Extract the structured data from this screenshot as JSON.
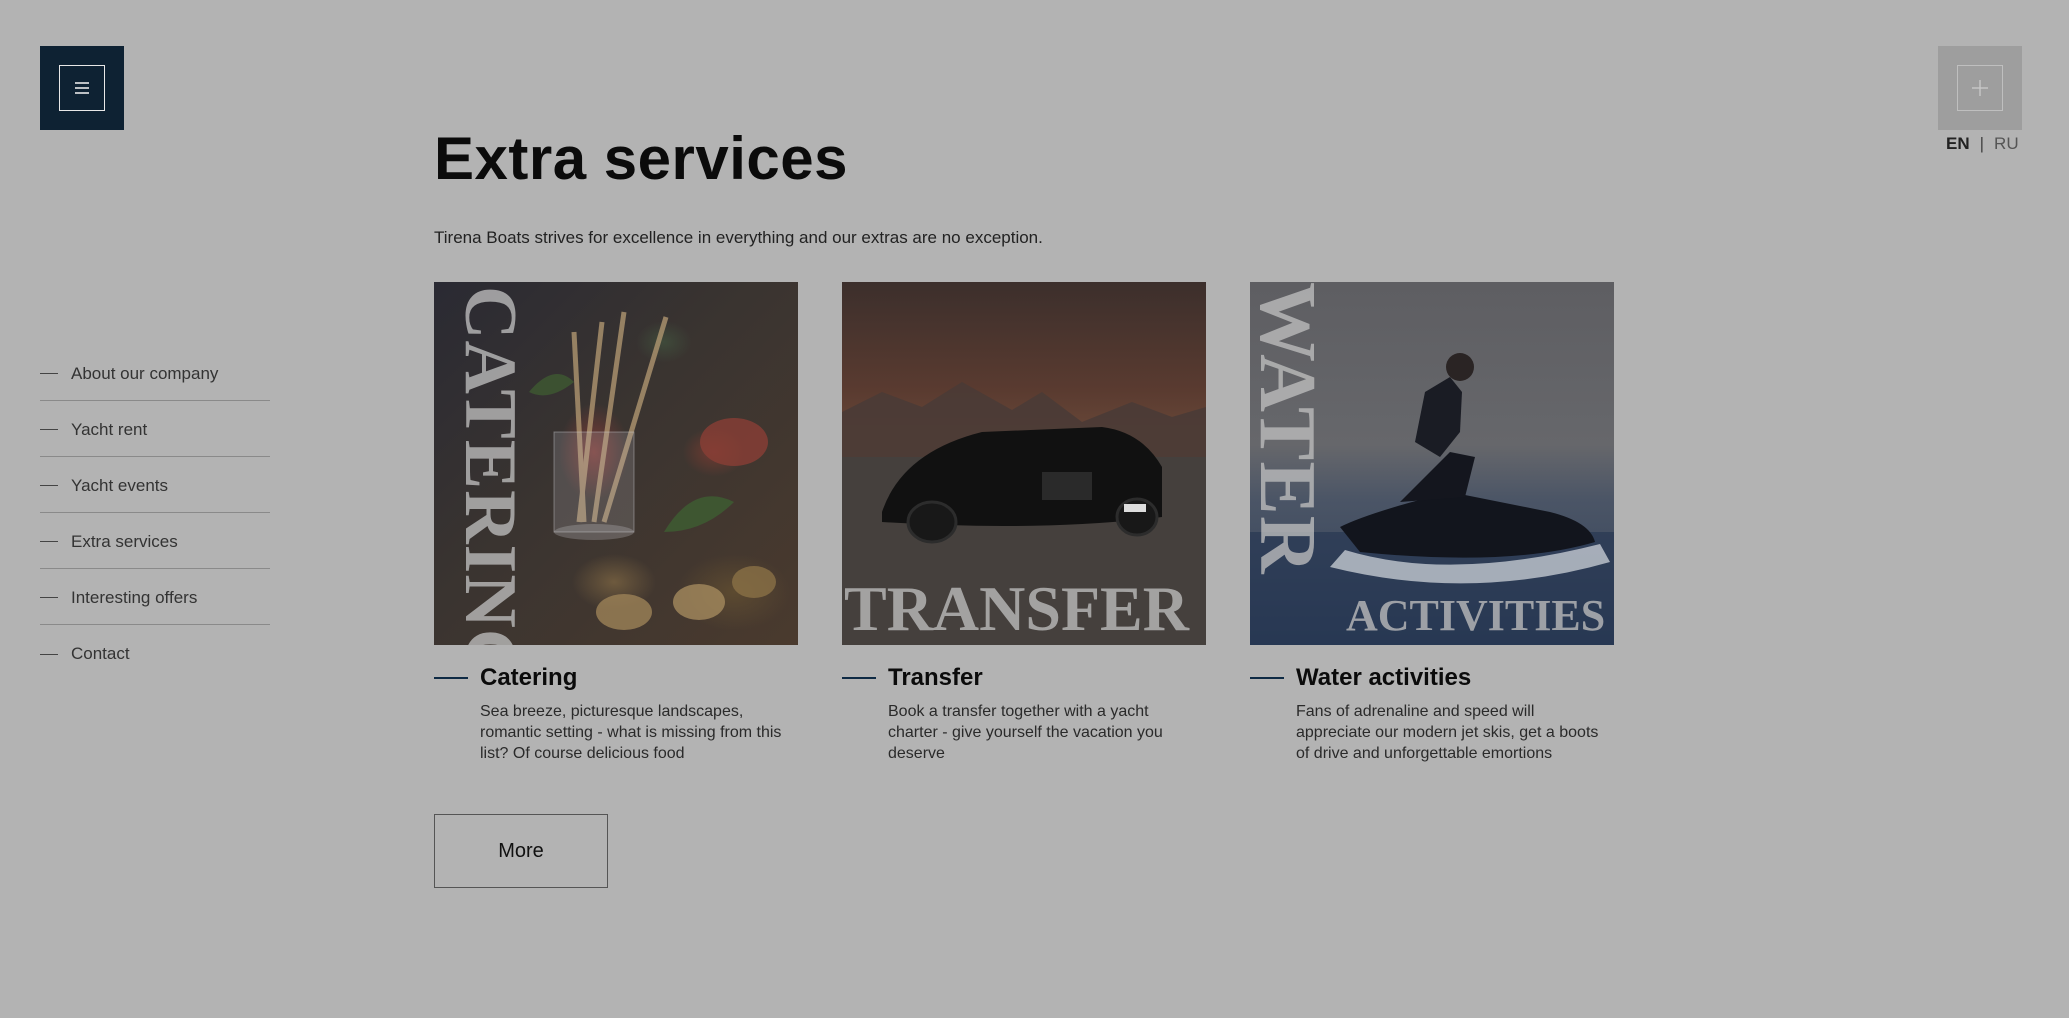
{
  "header": {
    "menu_icon": "hamburger-icon",
    "plus_icon": "plus-icon",
    "lang": {
      "en": "EN",
      "separator": "|",
      "ru": "RU"
    }
  },
  "page": {
    "title": "Extra services",
    "subtitle": "Tirena Boats strives for excellence in everything and our extras are no exception."
  },
  "sidebar": {
    "items": [
      {
        "label": "About our company"
      },
      {
        "label": "Yacht rent"
      },
      {
        "label": "Yacht events"
      },
      {
        "label": "Extra services"
      },
      {
        "label": "Interesting offers"
      },
      {
        "label": "Contact"
      }
    ]
  },
  "services": [
    {
      "image_word": "CATERING",
      "name": "Catering",
      "description": "Sea breeze, picturesque landscapes, romantic setting - what is missing from this list? Of course delicious food"
    },
    {
      "image_word": "TRANSFER",
      "name": "Transfer",
      "description": "Book a transfer together with a yacht charter - give yourself the vacation you deserve"
    },
    {
      "image_word": "WATER",
      "image_word_2": "ACTIVITIES",
      "name": "Water activities",
      "description": "Fans of adrenaline and speed will appreciate our modern jet skis, get a boots of drive and unforgettable emortions"
    }
  ],
  "more_button": {
    "label": "More"
  },
  "colors": {
    "background": "#b3b3b3",
    "menu_button": "#0e2233",
    "accent_dash": "#0e2a44"
  }
}
